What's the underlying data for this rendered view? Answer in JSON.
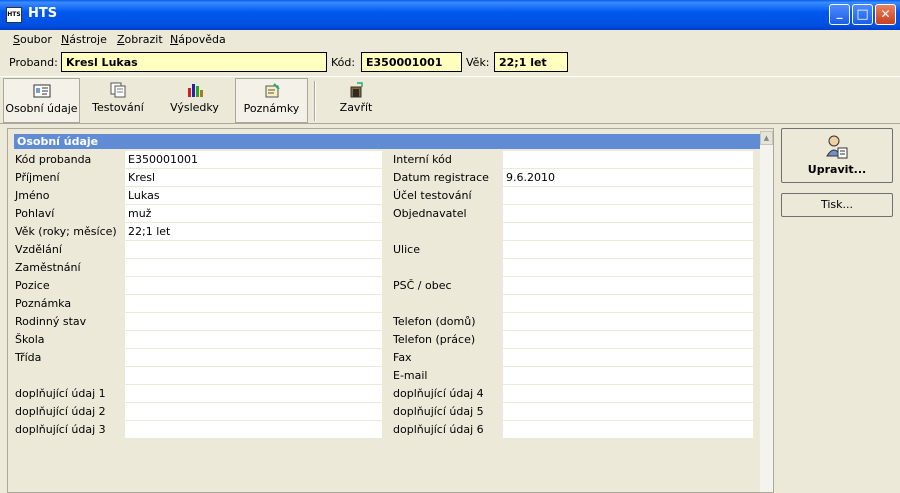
{
  "window": {
    "app_icon_text": "HTS",
    "title": "HTS",
    "minimize_glyph": "_",
    "maximize_glyph": "□",
    "close_glyph": "✕"
  },
  "menu": [
    {
      "accel": "S",
      "rest": "oubor"
    },
    {
      "accel": "N",
      "rest": "ástroje"
    },
    {
      "accel": "Z",
      "rest": "obrazit"
    },
    {
      "accel": "N",
      "rest": "ápověda"
    }
  ],
  "proband": {
    "name_label": "Proband:",
    "name_value": "Kresl Lukas",
    "code_label": "Kód:",
    "code_value": "E350001001",
    "age_label": "Věk:",
    "age_value": "22;1 let"
  },
  "toolbar": {
    "personal": "Osobní údaje",
    "testing": "Testování",
    "results": "Výsledky",
    "notes": "Poznámky",
    "close": "Zavřít"
  },
  "section": {
    "title": "Osobní údaje"
  },
  "left_fields": [
    {
      "label": "Kód probanda",
      "value": "E350001001"
    },
    {
      "label": "Příjmení",
      "value": "Kresl"
    },
    {
      "label": "Jméno",
      "value": "Lukas"
    },
    {
      "label": "Pohlaví",
      "value": "muž"
    },
    {
      "label": "Věk (roky; měsíce)",
      "value": "22;1 let"
    },
    {
      "label": "Vzdělání",
      "value": ""
    },
    {
      "label": "Zaměstnání",
      "value": ""
    },
    {
      "label": "Pozice",
      "value": ""
    },
    {
      "label": "Poznámka",
      "value": ""
    },
    {
      "label": "Rodinný stav",
      "value": ""
    },
    {
      "label": "Škola",
      "value": ""
    },
    {
      "label": "Třída",
      "value": ""
    },
    {
      "label": "",
      "value": ""
    },
    {
      "label": "doplňující údaj 1",
      "value": ""
    },
    {
      "label": "doplňující údaj 2",
      "value": ""
    },
    {
      "label": "doplňující údaj 3",
      "value": ""
    }
  ],
  "right_fields": [
    {
      "label": "Interní kód",
      "value": ""
    },
    {
      "label": "Datum registrace",
      "value": "9.6.2010"
    },
    {
      "label": "Účel testování",
      "value": ""
    },
    {
      "label": "Objednavatel",
      "value": ""
    },
    {
      "label": "",
      "value": ""
    },
    {
      "label": "Ulice",
      "value": ""
    },
    {
      "label": "",
      "value": ""
    },
    {
      "label": "PSČ / obec",
      "value": ""
    },
    {
      "label": "",
      "value": ""
    },
    {
      "label": "Telefon (domů)",
      "value": ""
    },
    {
      "label": "Telefon (práce)",
      "value": ""
    },
    {
      "label": "Fax",
      "value": ""
    },
    {
      "label": "E-mail",
      "value": ""
    },
    {
      "label": "doplňující údaj 4",
      "value": ""
    },
    {
      "label": "doplňující údaj 5",
      "value": ""
    },
    {
      "label": "doplňující údaj 6",
      "value": ""
    }
  ],
  "side": {
    "edit": "Upravit...",
    "print": "Tisk..."
  },
  "icons": {
    "personal": "id-card-icon",
    "testing": "documents-icon",
    "results": "bar-chart-icon",
    "notes": "notes-icon",
    "close": "exit-door-icon",
    "edit": "person-card-icon"
  },
  "colors": {
    "title_bar": "#0058EE",
    "section_header": "#5F8CD4",
    "highlight_field": "#FFFFC0",
    "window_bg": "#ECE9D8"
  }
}
